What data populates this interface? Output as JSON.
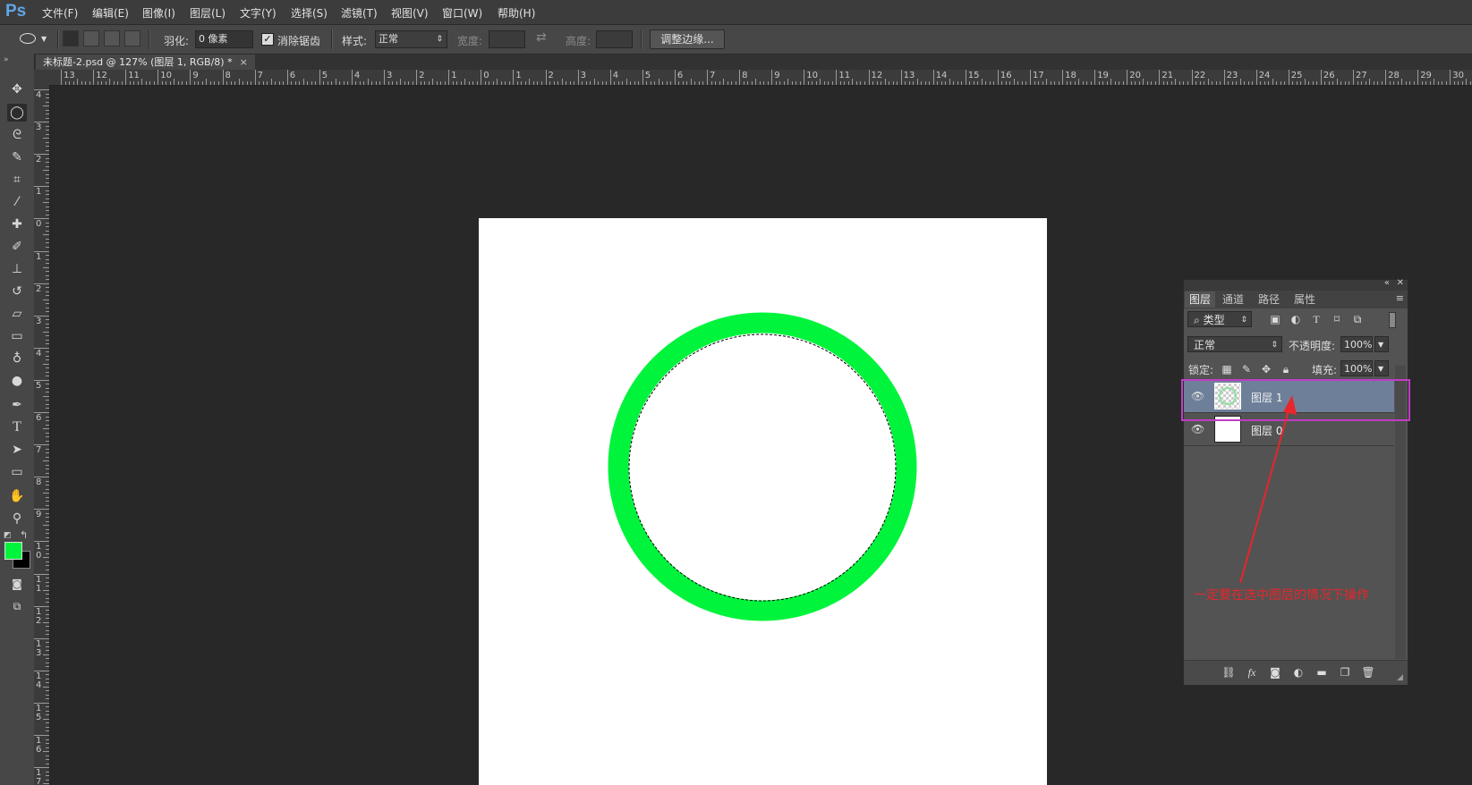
{
  "app": {
    "logo": "Ps"
  },
  "menu": [
    "文件(F)",
    "编辑(E)",
    "图像(I)",
    "图层(L)",
    "文字(Y)",
    "选择(S)",
    "滤镜(T)",
    "视图(V)",
    "窗口(W)",
    "帮助(H)"
  ],
  "options": {
    "feather_label": "羽化:",
    "feather_value": "0 像素",
    "antialias_label": "消除锯齿",
    "antialias_checked": true,
    "style_label": "样式:",
    "style_value": "正常",
    "width_label": "宽度:",
    "height_label": "高度:",
    "refine_button": "调整边缘..."
  },
  "document": {
    "tab_title": "未标题-2.psd @ 127% (图层 1, RGB/8) *",
    "close_glyph": "×"
  },
  "rulers": {
    "horizontal": [
      "13",
      "12",
      "11",
      "10",
      "9",
      "8",
      "7",
      "6",
      "5",
      "4",
      "3",
      "2",
      "1",
      "0",
      "1",
      "2",
      "3",
      "4",
      "5",
      "6",
      "7",
      "8",
      "9",
      "10",
      "11",
      "12",
      "13",
      "14",
      "15",
      "16",
      "17",
      "18",
      "19",
      "20",
      "21",
      "22",
      "23",
      "24",
      "25",
      "26",
      "27",
      "28",
      "29",
      "30"
    ],
    "vertical": [
      "4",
      "3",
      "2",
      "1",
      "0",
      "1",
      "2",
      "3",
      "4",
      "5",
      "6",
      "7",
      "8",
      "9",
      "1 0",
      "1 1",
      "1 2",
      "1 3",
      "1 4",
      "1 5",
      "1 6",
      "1 7"
    ]
  },
  "colors": {
    "ring": "#00f43b",
    "foreground": "#00f43b",
    "background": "#000000",
    "highlight": "#c23cc6",
    "annotation": "#e8262b"
  },
  "layers_panel": {
    "tabs": [
      "图层",
      "通道",
      "路径",
      "属性"
    ],
    "filter_kind": "类型",
    "blend_mode": "正常",
    "opacity_label": "不透明度:",
    "opacity_value": "100%",
    "lock_label": "锁定:",
    "fill_label": "填充:",
    "fill_value": "100%",
    "layers": [
      {
        "name": "图层 1",
        "selected": true
      },
      {
        "name": "图层 0",
        "selected": false
      }
    ]
  },
  "annotation": {
    "note": "一定要在选中图层的情况下操作"
  }
}
